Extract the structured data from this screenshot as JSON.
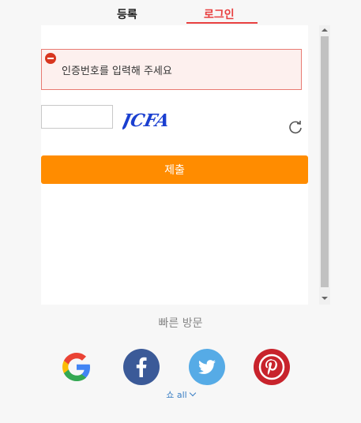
{
  "tabs": {
    "register_label": "등록",
    "login_label": "로그인",
    "active": "login"
  },
  "error": {
    "message": "인증번호를 입력해 주세요"
  },
  "captcha": {
    "value": "",
    "placeholder": "",
    "image_text": "JCFA"
  },
  "submit": {
    "label": "제출"
  },
  "quick_visit": {
    "title": "빠른 방문",
    "providers": [
      "google-icon",
      "facebook-icon",
      "twitter-icon",
      "pinterest-icon"
    ],
    "show_all_label": "쇼 all"
  },
  "colors": {
    "accent": "#ff8c00",
    "active_tab": "#e84040",
    "error_border": "#e87a72",
    "link": "#3b7fc4"
  }
}
